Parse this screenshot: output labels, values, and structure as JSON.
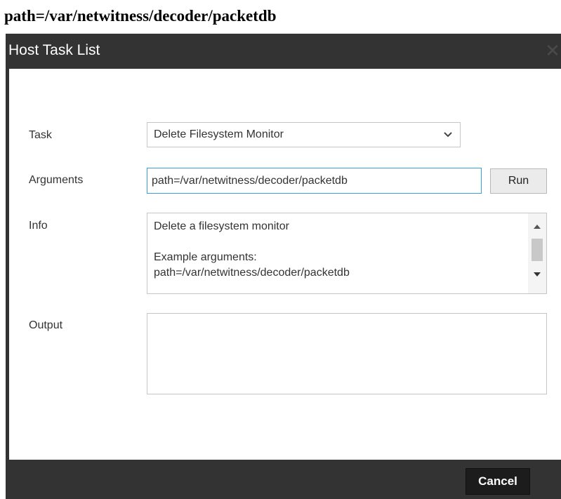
{
  "caption": "path=/var/netwitness/decoder/packetdb",
  "dialog": {
    "title": "Host Task List",
    "close_glyph": "✕"
  },
  "form": {
    "task_label": "Task",
    "task_selected": "Delete Filesystem Monitor",
    "arguments_label": "Arguments",
    "arguments_value": "path=/var/netwitness/decoder/packetdb",
    "run_label": "Run",
    "info_label": "Info",
    "info_text": "Delete a filesystem monitor\n\nExample arguments:\npath=/var/netwitness/decoder/packetdb",
    "output_label": "Output",
    "output_value": ""
  },
  "footer": {
    "cancel_label": "Cancel"
  },
  "icons": {
    "close": "close-icon",
    "select_arrow": "chevron-down-icon",
    "scroll_up": "scroll-up-icon",
    "scroll_down": "scroll-down-icon"
  },
  "colors": {
    "dialog_chrome": "#333333",
    "focus_border": "#3aa0d8",
    "cancel_button": "#1c1c1c"
  }
}
